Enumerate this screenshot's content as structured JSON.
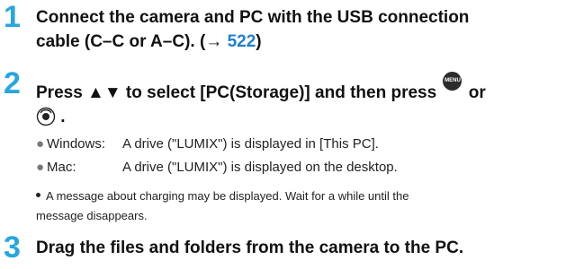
{
  "steps": [
    {
      "num": "1",
      "text_a": "Connect the camera and PC with the USB connection",
      "text_b": "cable (C–C or A–C). (→ ",
      "link": "522",
      "text_c": ")"
    },
    {
      "num": "2",
      "text_a": "Press ▲▼ to select [PC(Storage)] and then press",
      "or": "or",
      "end": "."
    },
    {
      "num": "3",
      "text": "Drag the files and folders from the camera to the PC."
    }
  ],
  "bullets": [
    {
      "os": "Windows:",
      "text": "A drive (\"LUMIX\") is displayed in [This PC]."
    },
    {
      "os": "Mac:",
      "text": "A drive (\"LUMIX\") is displayed on the desktop."
    }
  ],
  "note": {
    "line1": "A message about charging may be displayed. Wait for a while until the",
    "line2": "message disappears."
  },
  "icons": {
    "menu_set": "menu-set-button-icon",
    "control_dial": "control-dial-press-icon",
    "menu_text": "MENU SET"
  },
  "colors": {
    "step_number": "#27a6df",
    "link": "#1e7fd1"
  }
}
